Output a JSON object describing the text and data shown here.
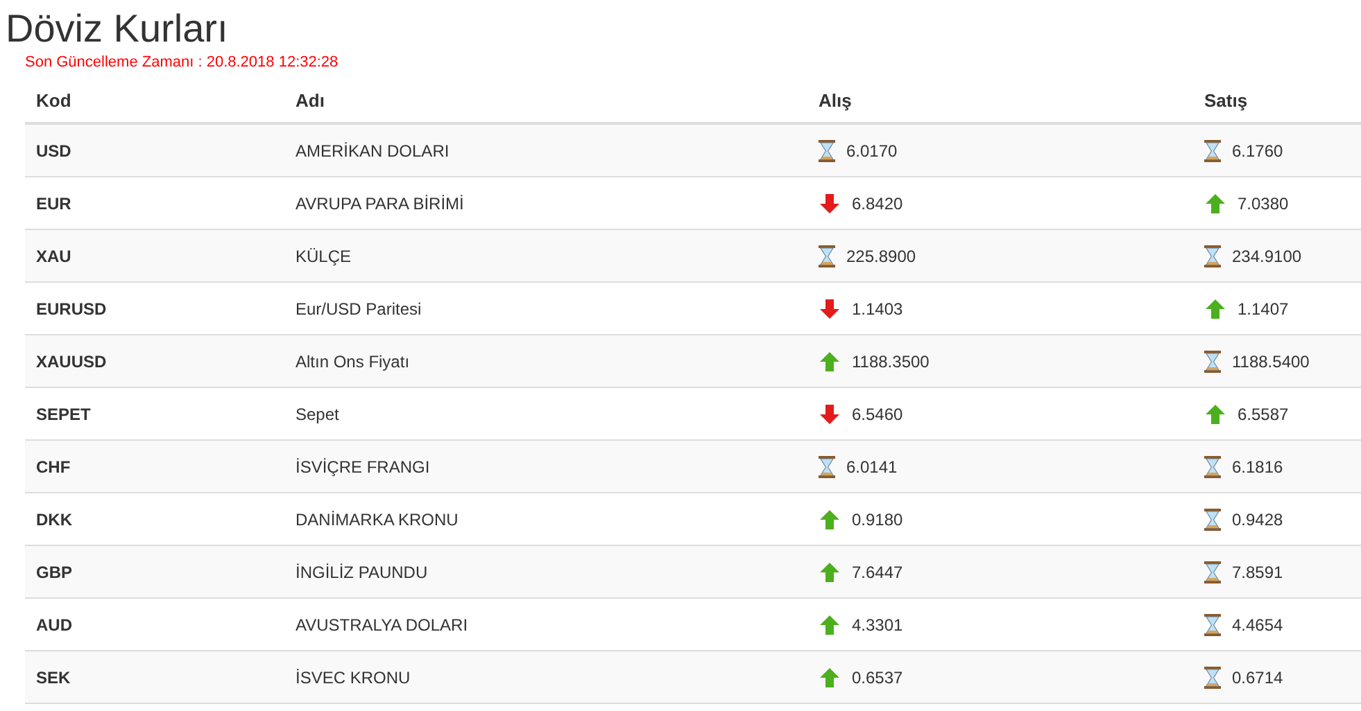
{
  "title": "Döviz Kurları",
  "updated": "Son Güncelleme Zamanı : 20.8.2018 12:32:28",
  "columns": [
    "Kod",
    "Adı",
    "Alış",
    "Satış"
  ],
  "rows": [
    {
      "code": "USD",
      "name": "AMERİKAN DOLARI",
      "buy": {
        "kind": "same",
        "value": "6.0170"
      },
      "sell": {
        "kind": "same",
        "value": "6.1760"
      }
    },
    {
      "code": "EUR",
      "name": "AVRUPA PARA BİRİMİ",
      "buy": {
        "kind": "down",
        "value": "6.8420"
      },
      "sell": {
        "kind": "up",
        "value": "7.0380"
      }
    },
    {
      "code": "XAU",
      "name": "KÜLÇE",
      "buy": {
        "kind": "same",
        "value": "225.8900"
      },
      "sell": {
        "kind": "same",
        "value": "234.9100"
      }
    },
    {
      "code": "EURUSD",
      "name": "Eur/USD Paritesi",
      "buy": {
        "kind": "down",
        "value": "1.1403"
      },
      "sell": {
        "kind": "up",
        "value": "1.1407"
      }
    },
    {
      "code": "XAUUSD",
      "name": "Altın Ons Fiyatı",
      "buy": {
        "kind": "up",
        "value": "1188.3500"
      },
      "sell": {
        "kind": "same",
        "value": "1188.5400"
      }
    },
    {
      "code": "SEPET",
      "name": "Sepet",
      "buy": {
        "kind": "down",
        "value": "6.5460"
      },
      "sell": {
        "kind": "up",
        "value": "6.5587"
      }
    },
    {
      "code": "CHF",
      "name": "İSVİÇRE FRANGI",
      "buy": {
        "kind": "same",
        "value": "6.0141"
      },
      "sell": {
        "kind": "same",
        "value": "6.1816"
      }
    },
    {
      "code": "DKK",
      "name": "DANİMARKA KRONU",
      "buy": {
        "kind": "up",
        "value": "0.9180"
      },
      "sell": {
        "kind": "same",
        "value": "0.9428"
      }
    },
    {
      "code": "GBP",
      "name": "İNGİLİZ PAUNDU",
      "buy": {
        "kind": "up",
        "value": "7.6447"
      },
      "sell": {
        "kind": "same",
        "value": "7.8591"
      }
    },
    {
      "code": "AUD",
      "name": "AVUSTRALYA DOLARI",
      "buy": {
        "kind": "up",
        "value": "4.3301"
      },
      "sell": {
        "kind": "same",
        "value": "4.4654"
      }
    },
    {
      "code": "SEK",
      "name": "İSVEC KRONU",
      "buy": {
        "kind": "up",
        "value": "0.6537"
      },
      "sell": {
        "kind": "same",
        "value": "0.6714"
      }
    }
  ]
}
